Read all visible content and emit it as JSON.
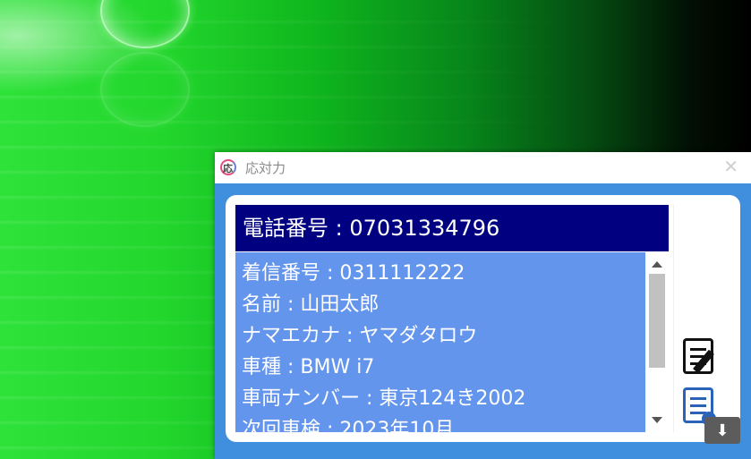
{
  "window": {
    "title": "応対力",
    "close_glyph": "✕"
  },
  "caller": {
    "phone_label": "電話番号 : 07031334796"
  },
  "details": [
    "着信番号 : 0311112222",
    "名前 : 山田太郎",
    "ナマエカナ : ヤマダタロウ",
    "車種 : BMW i7",
    "車両ナンバー : 東京124き2002",
    "次回車検 : 2023年10月"
  ],
  "icons": {
    "app": "app-logo-icon",
    "memo": "memo-edit-icon",
    "list": "record-list-icon",
    "download": "download-arrow-icon",
    "download_glyph": "⬇"
  },
  "colors": {
    "phone_bar": "#000080",
    "info_box": "#6495ed",
    "window_frame": "#3f8fde"
  }
}
